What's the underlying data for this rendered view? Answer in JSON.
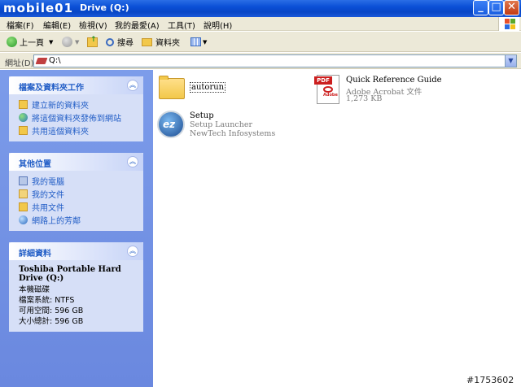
{
  "window": {
    "watermark": "mobile01",
    "title": "Drive (Q:)",
    "buttons": {
      "minimize": "_",
      "maximize": "□",
      "close": "✕"
    }
  },
  "menu": [
    "檔案(F)",
    "編輯(E)",
    "檢視(V)",
    "我的最愛(A)",
    "工具(T)",
    "說明(H)"
  ],
  "toolbar": {
    "back": "上一頁",
    "search": "搜尋",
    "folders": "資料夾"
  },
  "address": {
    "label": "網址(D)",
    "value": "Q:\\"
  },
  "tasks_panel": {
    "title": "檔案及資料夾工作",
    "items": [
      "建立新的資料夾",
      "將這個資料夾發佈到網站",
      "共用這個資料夾"
    ]
  },
  "places_panel": {
    "title": "其他位置",
    "items": [
      "我的電腦",
      "我的文件",
      "共用文件",
      "網路上的芳鄰"
    ]
  },
  "details_panel": {
    "title": "詳細資料",
    "drive_name": "Toshiba Portable Hard Drive (Q:)",
    "type": "本機磁碟",
    "filesystem": "檔案系統: NTFS",
    "free": "可用空間: 596 GB",
    "total": "大小總計: 596 GB"
  },
  "files": [
    {
      "name": "autorun",
      "type": "",
      "detail": "",
      "icon": "folder-icon"
    },
    {
      "name": "Quick Reference Guide",
      "type": "Adobe Acrobat 文件",
      "detail": "1,273 KB",
      "icon": "pdf-icon",
      "icon_label": "PDF",
      "icon_brand": "Adobe"
    },
    {
      "name": "Setup",
      "type": "Setup Launcher",
      "detail": "NewTech Infosystems",
      "icon": "setup-icon",
      "icon_label": "ez"
    }
  ],
  "photo_id": "#1753602",
  "colors": {
    "title_blue": "#0a4fd6",
    "task_link": "#215dc6",
    "pane_bg": "#7c9cea",
    "pdf_red": "#cc1f1f"
  }
}
